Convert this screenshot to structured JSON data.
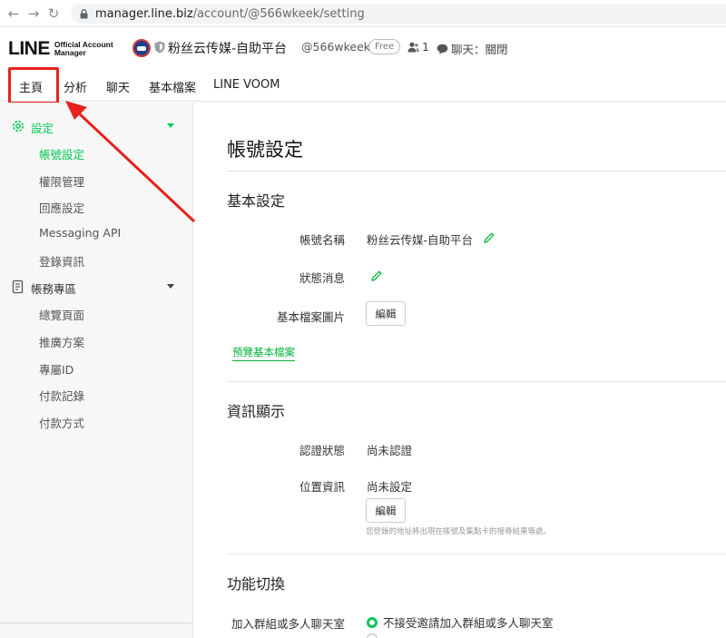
{
  "browser": {
    "url_host": "manager.line.biz",
    "url_path": "/account/@566wkeek/setting"
  },
  "header": {
    "logo_text": "LINE",
    "logo_sub_1": "Official Account",
    "logo_sub_2": "Manager",
    "account_name": "粉丝云传媒-自助平台",
    "account_id": "@566wkeek",
    "plan": "Free",
    "friends_count": "1",
    "chat_status": "聊天：關閉"
  },
  "tabs": [
    {
      "label": "主頁"
    },
    {
      "label": "分析"
    },
    {
      "label": "聊天"
    },
    {
      "label": "基本檔案"
    },
    {
      "label": "LINE VOOM"
    }
  ],
  "sidebar": {
    "settings": {
      "label": "設定",
      "items": [
        "帳號設定",
        "權限管理",
        "回應設定",
        "Messaging API",
        "登錄資訊"
      ]
    },
    "account_area": {
      "label": "帳務專區",
      "items": [
        "總覽頁面",
        "推廣方案",
        "專屬ID",
        "付款記錄",
        "付款方式"
      ]
    }
  },
  "main": {
    "page_title": "帳號設定",
    "basic": {
      "title": "基本設定",
      "account_name_label": "帳號名稱",
      "account_name_value": "粉丝云传媒-自助平台",
      "status_label": "狀態消息",
      "profile_image_label": "基本檔案圖片",
      "edit_label": "編輯",
      "preview_link": "預覽基本檔案"
    },
    "info": {
      "title": "資訊顯示",
      "auth_label": "認證狀態",
      "auth_value": "尚未認證",
      "location_label": "位置資訊",
      "location_value": "尚未設定",
      "edit_label": "編輯",
      "hint": "您登錄的地址將出現在帳號及集點卡的搜尋結果等處。"
    },
    "features": {
      "title": "功能切換",
      "group_label": "加入群組或多人聊天室",
      "option_1": "不接受邀請加入群組或多人聊天室"
    }
  },
  "colors": {
    "accent_green": "#06c755",
    "highlight_red": "#e8211c"
  }
}
